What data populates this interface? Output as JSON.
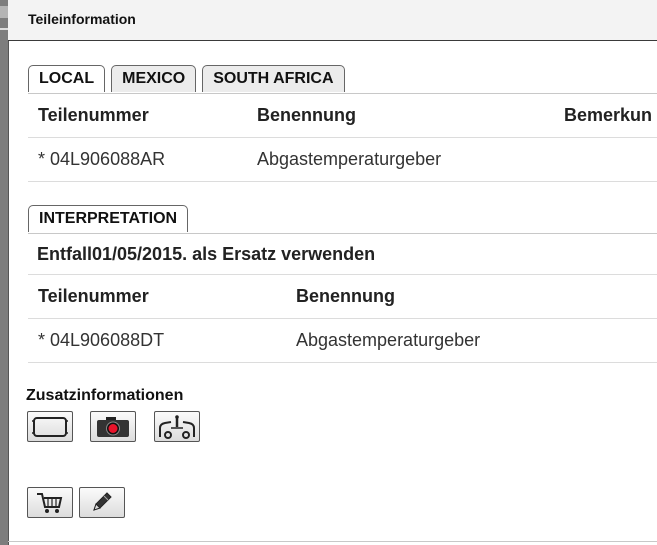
{
  "window": {
    "title": "Teileinformation"
  },
  "tabs": [
    "LOCAL",
    "MEXICO",
    "SOUTH AFRICA"
  ],
  "parts_table": {
    "headers": [
      "Teilenummer",
      "Benennung",
      "Bemerkun"
    ],
    "rows": [
      {
        "number": "* 04L906088AR",
        "name": "Abgastemperaturgeber"
      }
    ]
  },
  "interpretation": {
    "tab_label": "INTERPRETATION",
    "note": "Entfall01/05/2015. als Ersatz verwenden",
    "headers": [
      "Teilenummer",
      "Benennung"
    ],
    "rows": [
      {
        "number": "* 04L906088DT",
        "name": "Abgastemperaturgeber"
      }
    ]
  },
  "additional_info": {
    "title": "Zusatzinformationen",
    "icons": [
      "frame-icon",
      "camera-icon",
      "vehicle-icon"
    ]
  },
  "actions": {
    "icons": [
      "cart-icon",
      "pencil-icon"
    ]
  },
  "colors": {
    "camera_dot": "#e8132a",
    "border": "#555555"
  }
}
